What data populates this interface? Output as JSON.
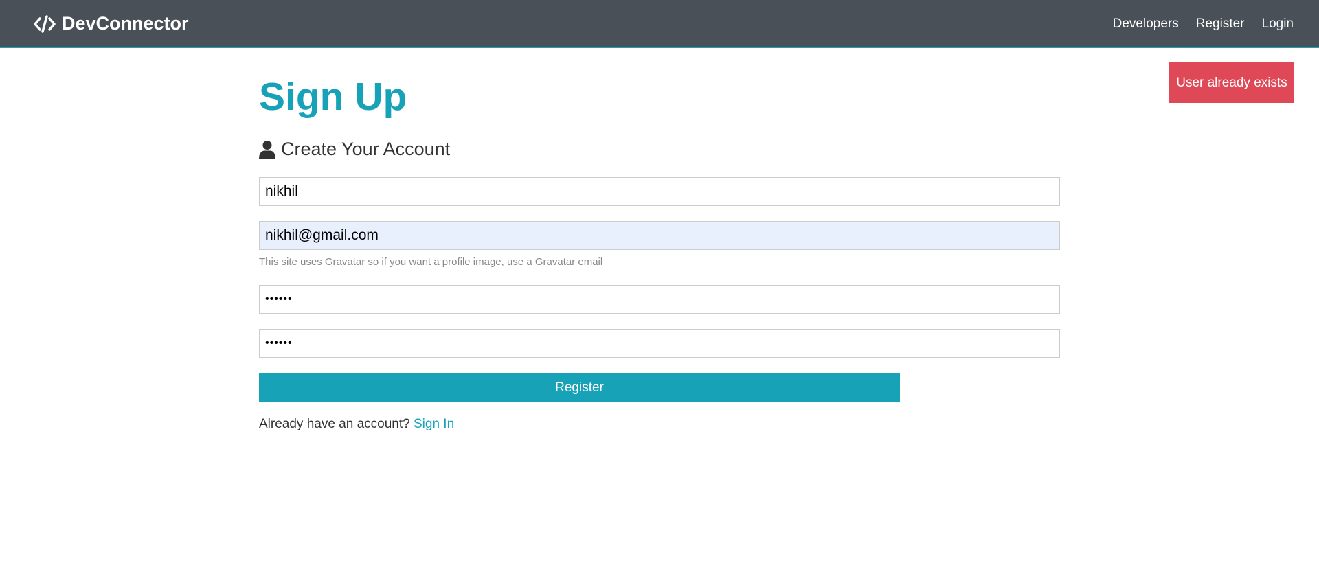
{
  "navbar": {
    "brand": "DevConnector",
    "brand_icon": "code-icon",
    "links": [
      "Developers",
      "Register",
      "Login"
    ]
  },
  "alert": {
    "text": "User already exists",
    "color": "#dc3545"
  },
  "main": {
    "title": "Sign Up",
    "subtitle": "Create Your Account",
    "subtitle_icon": "user-icon",
    "fields": {
      "name": {
        "value": "nikhil"
      },
      "email": {
        "value": "nikhil@gmail.com"
      },
      "email_hint": "This site uses Gravatar so if you want a profile image, use a Gravatar email",
      "password": {
        "value": "••••••"
      },
      "password_confirm": {
        "value": "••••••"
      }
    },
    "submit_label": "Register",
    "signin_prompt": "Already have an account?",
    "signin_link": "Sign In"
  },
  "colors": {
    "primary": "#17a2b8",
    "navbar": "#495057",
    "danger": "#dc3545"
  }
}
